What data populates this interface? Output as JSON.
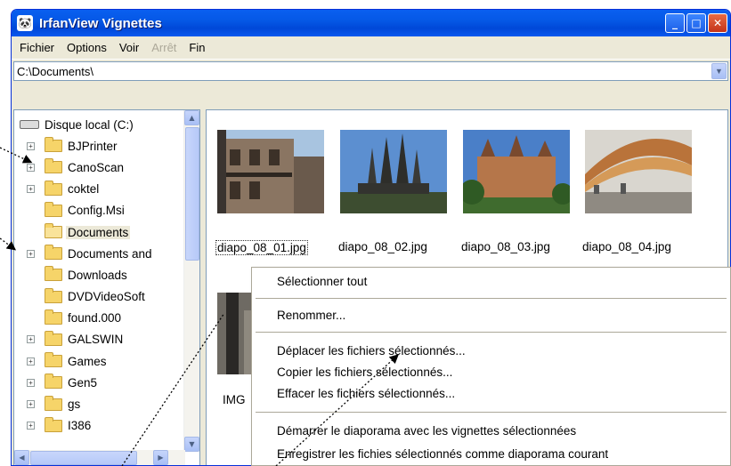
{
  "window": {
    "title": "IrfanView Vignettes"
  },
  "menu": [
    {
      "label": "Fichier",
      "disabled": false
    },
    {
      "label": "Options",
      "disabled": false
    },
    {
      "label": "Voir",
      "disabled": false
    },
    {
      "label": "Arrêt",
      "disabled": true
    },
    {
      "label": "Fin",
      "disabled": false
    }
  ],
  "address": {
    "value": "C:\\Documents\\"
  },
  "tree": {
    "root": "Disque local (C:)",
    "items": [
      {
        "label": "BJPrinter",
        "expander": true
      },
      {
        "label": "CanoScan",
        "expander": true
      },
      {
        "label": "coktel",
        "expander": true
      },
      {
        "label": "Config.Msi",
        "expander": false
      },
      {
        "label": "Documents",
        "expander": false,
        "selected": true
      },
      {
        "label": "Documents and",
        "expander": true
      },
      {
        "label": "Downloads",
        "expander": false
      },
      {
        "label": "DVDVideoSoft",
        "expander": false
      },
      {
        "label": "found.000",
        "expander": false
      },
      {
        "label": "GALSWIN",
        "expander": true
      },
      {
        "label": "Games",
        "expander": true
      },
      {
        "label": "Gen5",
        "expander": true
      },
      {
        "label": "gs",
        "expander": true
      },
      {
        "label": "I386",
        "expander": true
      }
    ]
  },
  "thumbnails": [
    {
      "name": "diapo_08_01.jpg",
      "selected": true
    },
    {
      "name": "diapo_08_02.jpg",
      "selected": false
    },
    {
      "name": "diapo_08_03.jpg",
      "selected": false
    },
    {
      "name": "diapo_08_04.jpg",
      "selected": false
    }
  ],
  "partial_thumb": {
    "name": "IMG"
  },
  "context_menu": [
    "Sélectionner tout",
    "Renommer...",
    "Déplacer les fichiers sélectionnés...",
    "Copier les fichiers sélectionnés...",
    "Effacer  les fichiers sélectionnés...",
    "Démarrer le diaporama avec les vignettes sélectionnées",
    "Enregistrer les fichies sélectionnés comme diaporama courant"
  ]
}
